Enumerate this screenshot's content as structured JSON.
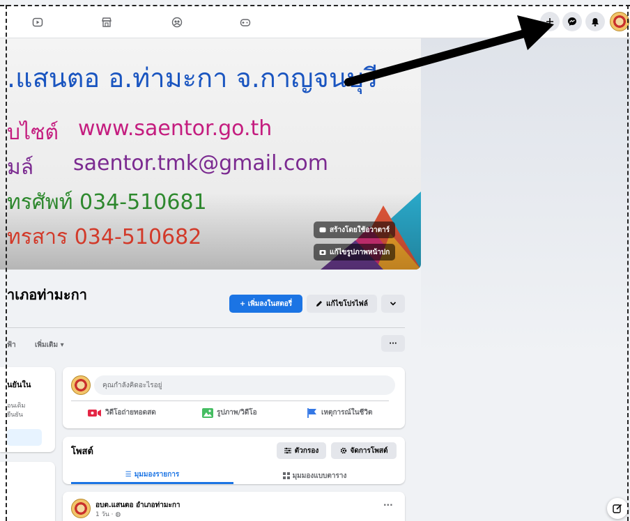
{
  "cover": {
    "title": ".แสนตอ อ.ท่ามะกา จ.กาญจนบุรี",
    "website_label": "บไซต์",
    "website_value": "www.saentor.go.th",
    "email_label": "มล์",
    "email_value": "saentor.tmk@gmail.com",
    "phone_line": "ทรศัพท์ 034-510681",
    "fax_line": "ทรสาร  034-510682",
    "create_avatar_label": "สร้างโดยใช้อวาตาร์",
    "edit_cover_label": "แก้ไขรูปภาพหน้าปก"
  },
  "profile": {
    "name": "าเภอท่ามะกา",
    "add_story_label": "+ เพิ่มลงในสตอรี่",
    "edit_profile_label": "แก้ไขโปรไฟล์"
  },
  "tabs": {
    "partial_label": "ฟ้า",
    "more_label": "เพิ่มเติม ▾",
    "more_options": "···"
  },
  "intro": {
    "title": "นยันใน",
    "line1": "อนเดิม",
    "line2": "ยืนยัน"
  },
  "composer": {
    "placeholder": "คุณกำลังคิดอะไรอยู่",
    "live_video_label": "วิดีโอถ่ายทอดสด",
    "photo_video_label": "รูปภาพ/วิดีโอ",
    "life_event_label": "เหตุการณ์ในชีวิต"
  },
  "posts": {
    "title": "โพสต์",
    "filter_label": "ตัวกรอง",
    "manage_label": "จัดการโพสต์",
    "list_view_label": "มุมมองรายการ",
    "grid_view_label": "มุมมองแบบตาราง"
  },
  "post": {
    "author": "อบต.แสนตอ อำเภอท่ามะกา",
    "time": "1 วัน ·",
    "more": "···"
  },
  "colors": {
    "accent": "#1b74e4",
    "title_blue": "#1a55c0"
  }
}
